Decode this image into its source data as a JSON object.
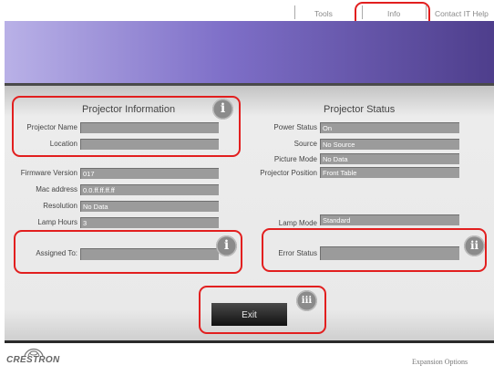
{
  "nav": {
    "tools": "Tools",
    "info": "Info",
    "contact": "Contact IT Help"
  },
  "projector_information": {
    "title": "Projector Information",
    "projector_name_label": "Projector Name",
    "projector_name_value": "",
    "location_label": "Location",
    "location_value": "",
    "firmware_label": "Firmware Version",
    "firmware_value": "017",
    "mac_label": "Mac address",
    "mac_value": "0.0.ff.ff.ff.ff",
    "resolution_label": "Resolution",
    "resolution_value": "No Data",
    "lamp_hours_label": "Lamp Hours",
    "lamp_hours_value": "3",
    "assigned_label": "Assigned To:",
    "assigned_value": ""
  },
  "projector_status": {
    "title": "Projector Status",
    "power_label": "Power Status",
    "power_value": "On",
    "source_label": "Source",
    "source_value": "No Source",
    "picture_label": "Picture Mode",
    "picture_value": "No Data",
    "position_label": "Projector Position",
    "position_value": "Front Table",
    "lamp_mode_label": "Lamp Mode",
    "lamp_mode_value": "Standard",
    "error_label": "Error Status",
    "error_value": ""
  },
  "badges": {
    "b1": "i",
    "b2": "i",
    "b3": "ii",
    "b4": "iii"
  },
  "exit_label": "Exit",
  "logo_text": "CRESTRON",
  "footer_link": "Expansion Options",
  "colors": {
    "highlight": "#e21f1f",
    "banner_dark": "#4e3e8c",
    "banner_light": "#b9b1e7"
  }
}
